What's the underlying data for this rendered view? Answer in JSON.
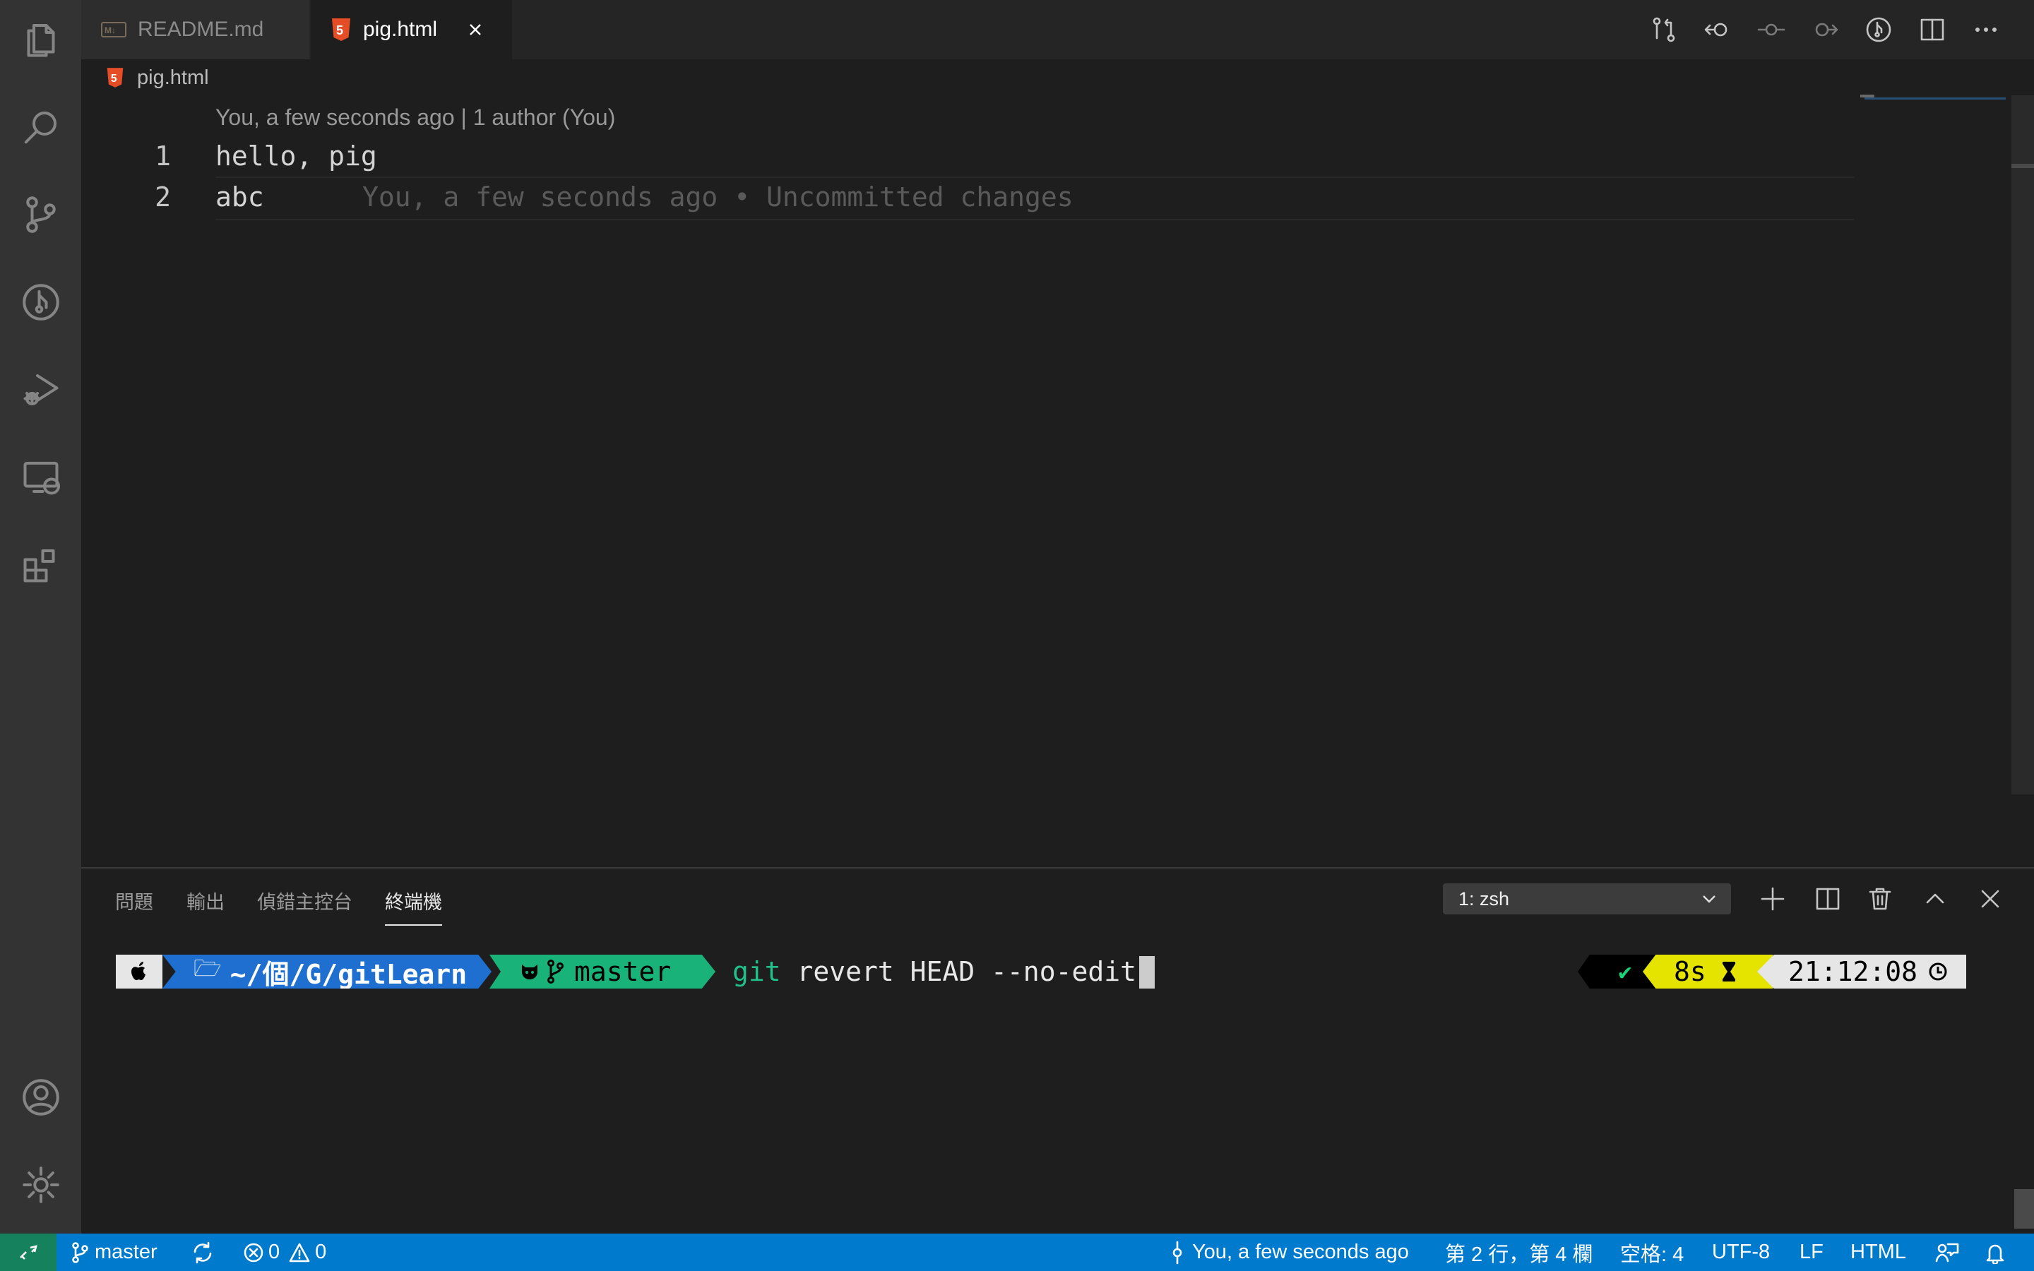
{
  "tabs": [
    {
      "label": "README.md",
      "icon": "markdown-icon"
    },
    {
      "label": "pig.html",
      "icon": "html5-icon",
      "active": true
    }
  ],
  "breadcrumb": {
    "file": "pig.html"
  },
  "codelens": "You, a few seconds ago | 1 author (You)",
  "editor": {
    "lines": [
      {
        "num": "1",
        "text": "hello, pig"
      },
      {
        "num": "2",
        "text": "abc",
        "blame": "You, a few seconds ago • Uncommitted changes"
      }
    ]
  },
  "panel": {
    "tabs": [
      "問題",
      "輸出",
      "偵錯主控台",
      "終端機"
    ],
    "terminal_select": "1: zsh"
  },
  "terminal": {
    "path": "~/個/G/gitLearn",
    "path_icon": "folder-icon",
    "branch": "master",
    "command_git": "git",
    "command_rest": " revert HEAD --no-edit",
    "status_check": "✔",
    "duration": "8s",
    "duration_icon": "hourglass-icon",
    "time": "21:12:08",
    "time_icon": "clock-icon"
  },
  "statusbar": {
    "branch": "master",
    "errors": "0",
    "warnings": "0",
    "blame": "You, a few seconds ago",
    "position": "第 2 行，第 4 欄",
    "spaces": "空格: 4",
    "encoding": "UTF-8",
    "eol": "LF",
    "language": "HTML"
  },
  "colors": {
    "activity_bar": "#333333",
    "editor_bg": "#1e1e1e",
    "status_bar": "#007acc",
    "remote_indicator": "#16825d",
    "prompt_path_bg": "#1e6fcf",
    "prompt_git_bg": "#19b37a",
    "prompt_time_bg": "#e6e6e6",
    "prompt_duration_bg": "#e4e400",
    "git_command": "#21c08b",
    "html_icon": "#e44d26"
  }
}
